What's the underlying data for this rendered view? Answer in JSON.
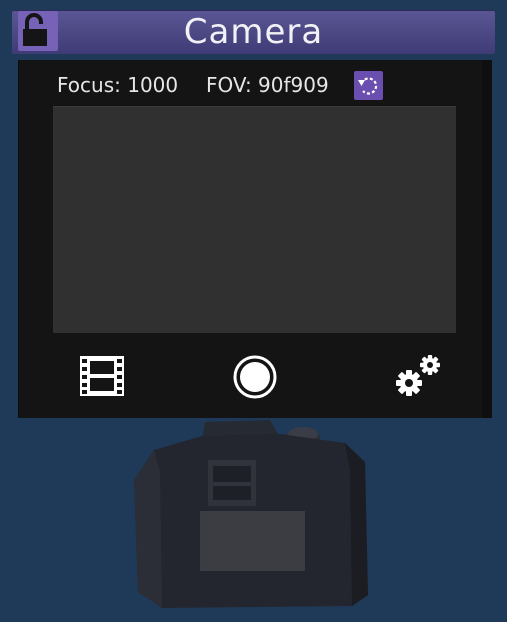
{
  "window": {
    "title": "Camera"
  },
  "readouts": {
    "focus": "Focus: 1000",
    "fov": "FOV: 90f909"
  },
  "icons": {
    "lock": "unlock-icon",
    "reset": "reset-icon",
    "film": "film-icon",
    "shutter": "shutter-icon",
    "settings": "gears-icon"
  },
  "colors": {
    "titlebar": "#4b4884",
    "lock_button": "#7662b6",
    "reset_button": "#6a4fb0",
    "panel": "#141414",
    "viewport": "#303030",
    "background": "#1f3a58"
  }
}
